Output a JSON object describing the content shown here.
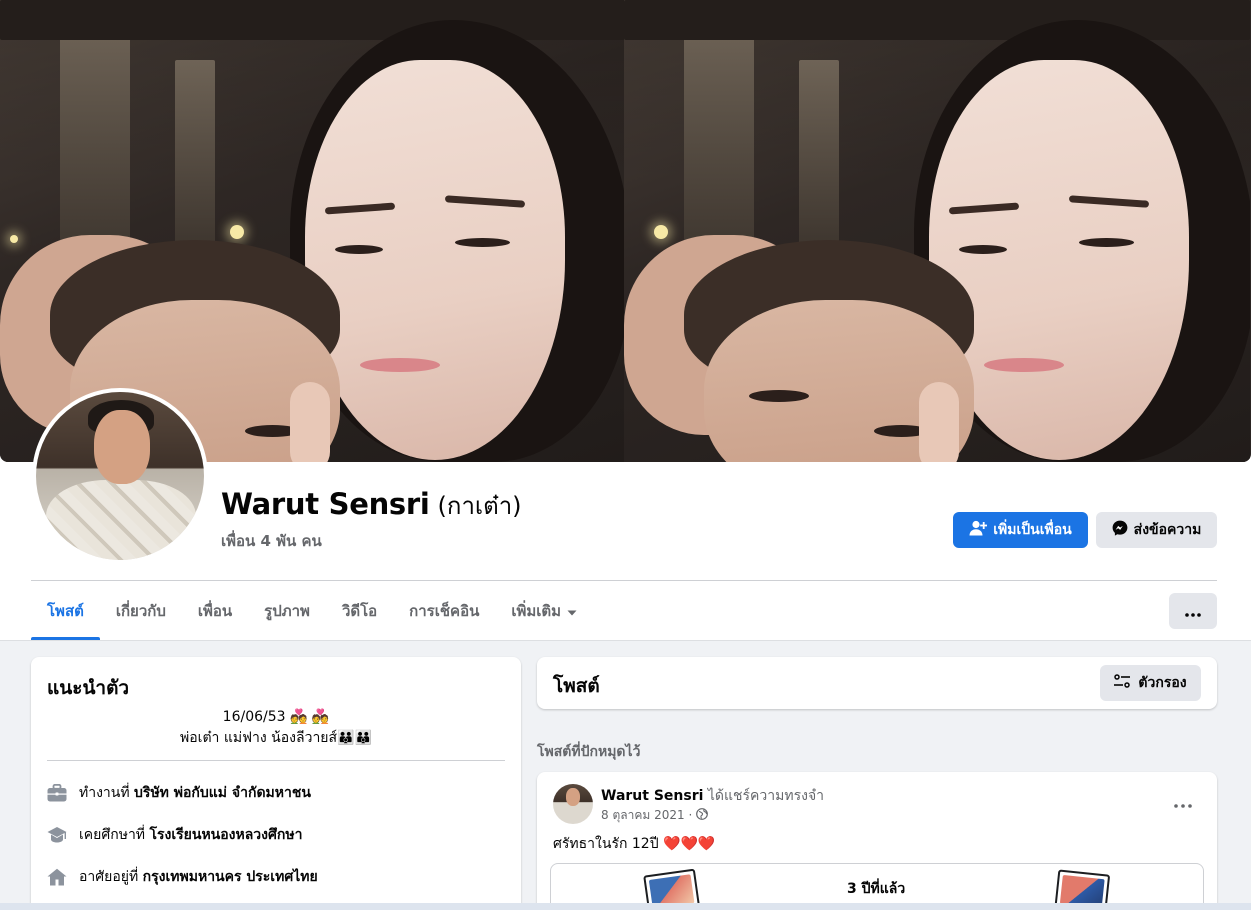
{
  "profile": {
    "name": "Warut Sensri",
    "alt_name": "(กาเต๋า)",
    "friends": "เพื่อน 4 พัน คน"
  },
  "actions": {
    "add_friend": "เพิ่มเป็นเพื่อน",
    "message": "ส่งข้อความ"
  },
  "tabs": [
    {
      "label": "โพสต์",
      "active": true
    },
    {
      "label": "เกี่ยวกับ",
      "active": false
    },
    {
      "label": "เพื่อน",
      "active": false
    },
    {
      "label": "รูปภาพ",
      "active": false
    },
    {
      "label": "วิดีโอ",
      "active": false
    },
    {
      "label": "การเช็คอิน",
      "active": false
    },
    {
      "label": "เพิ่มเติม",
      "active": false
    }
  ],
  "intro": {
    "title": "แนะนำตัว",
    "bio_line1": "16/06/53",
    "bio_line1_emoji": "💑 💑",
    "bio_line2": "พ่อเต๋า แม่ฟาง น้องลีวายส์",
    "bio_line2_emoji": "👪👪",
    "work_prefix": "ทำงานที่",
    "work_value": "บริษัท พ่อกับแม่ จำกัดมหาชน",
    "study_prefix": "เคยศึกษาที่",
    "study_value": "โรงเรียนหนองหลวงศึกษา",
    "live_prefix": "อาศัยอยู่ที่",
    "live_value": "กรุงเทพมหานคร ประเทศไทย"
  },
  "posts": {
    "title": "โพสต์",
    "filter_label": "ตัวกรอง",
    "pinned_label": "โพสต์ที่ปักหมุดไว้"
  },
  "post": {
    "author": "Warut Sensri",
    "action": "ได้แชร์ความทรงจำ",
    "date": "8 ตุลาคม 2021 ·",
    "text": "ศรัทธาในรัก 12ปี",
    "hearts": "❤️❤️❤️",
    "memory_title": "3 ปีที่แล้ว"
  },
  "icons": {
    "more_tab_caret": "caret-down-icon",
    "more_options": "more-horizontal-icon",
    "globe": "globe-icon"
  },
  "colors": {
    "accent": "#1b74e4",
    "secondary_text": "#65676b",
    "button_gray": "#e4e6eb",
    "page_bg": "#f0f2f5"
  }
}
